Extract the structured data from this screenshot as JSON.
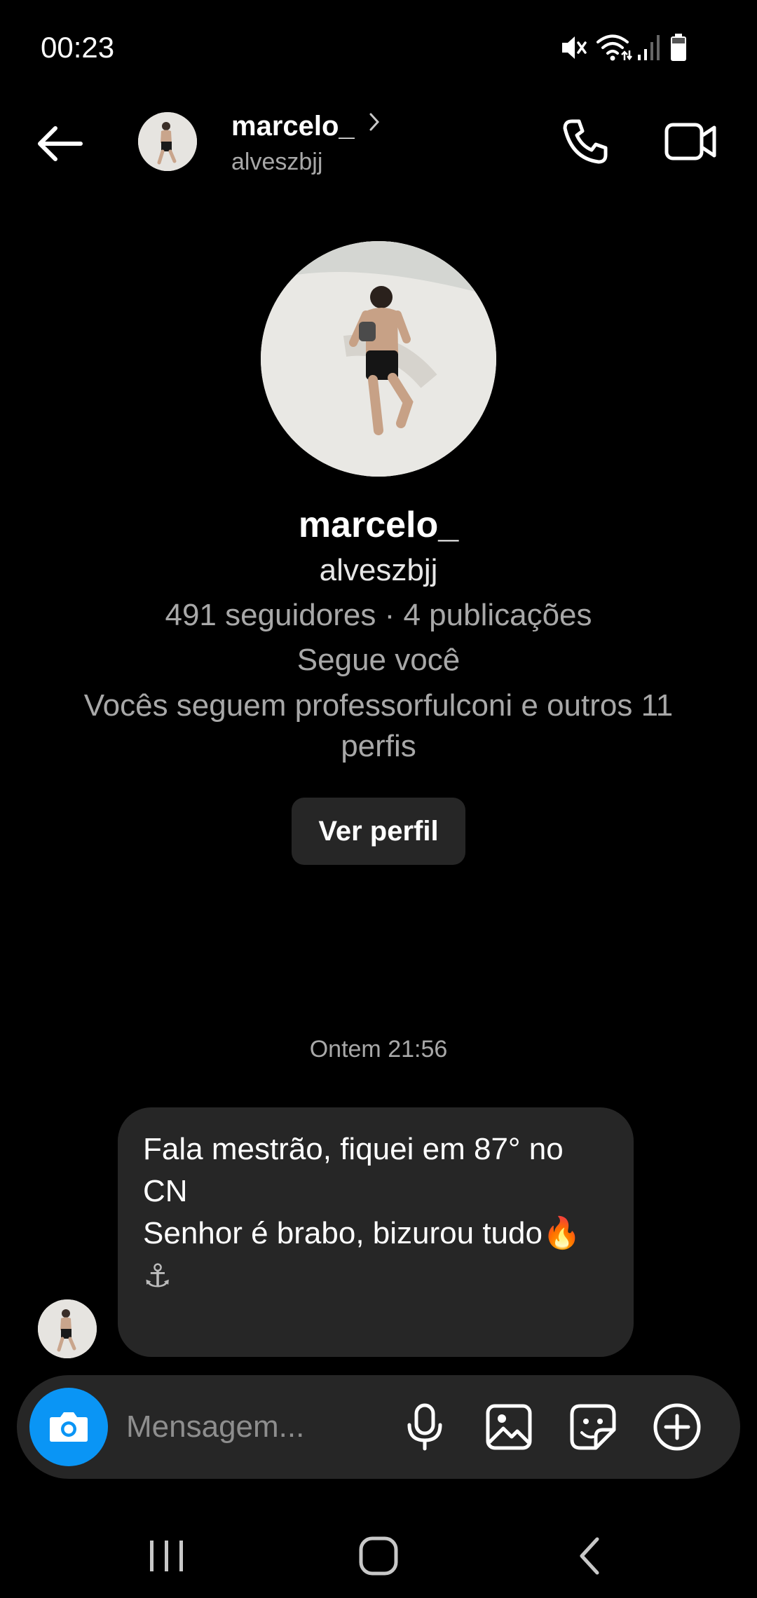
{
  "status_bar": {
    "time": "00:23",
    "icons": [
      "mute-icon",
      "wifi-icon",
      "signal-icon",
      "battery-icon"
    ]
  },
  "header": {
    "name": "marcelo_",
    "username": "alveszbjj",
    "icons": [
      "back-arrow-icon",
      "chevron-right-icon",
      "phone-icon",
      "video-camera-icon"
    ]
  },
  "profile": {
    "name": "marcelo_",
    "username": "alveszbjj",
    "stats": "491 seguidores · 4 publicações",
    "follows_you": "Segue você",
    "mutual": "Vocês seguem professorfulconi e outros 11 perfis",
    "view_profile_label": "Ver perfil"
  },
  "conversation": {
    "timestamp": "Ontem 21:56",
    "messages": [
      {
        "from": "them",
        "lines": [
          "Fala mestrão, fiquei em 87° no CN",
          "",
          "Senhor é brabo, bizurou tudo🔥"
        ],
        "trailing_glyph": "⚓"
      }
    ]
  },
  "composer": {
    "placeholder": "Mensagem...",
    "icons": [
      "camera-icon",
      "microphone-icon",
      "gallery-icon",
      "sticker-icon",
      "add-icon"
    ]
  },
  "nav_bar": {
    "icons": [
      "recents-icon",
      "home-icon",
      "back-icon"
    ]
  },
  "colors": {
    "background": "#000000",
    "bubble": "#262626",
    "secondary_text": "#a8a8a8",
    "camera_accent": "#0a95f5"
  }
}
